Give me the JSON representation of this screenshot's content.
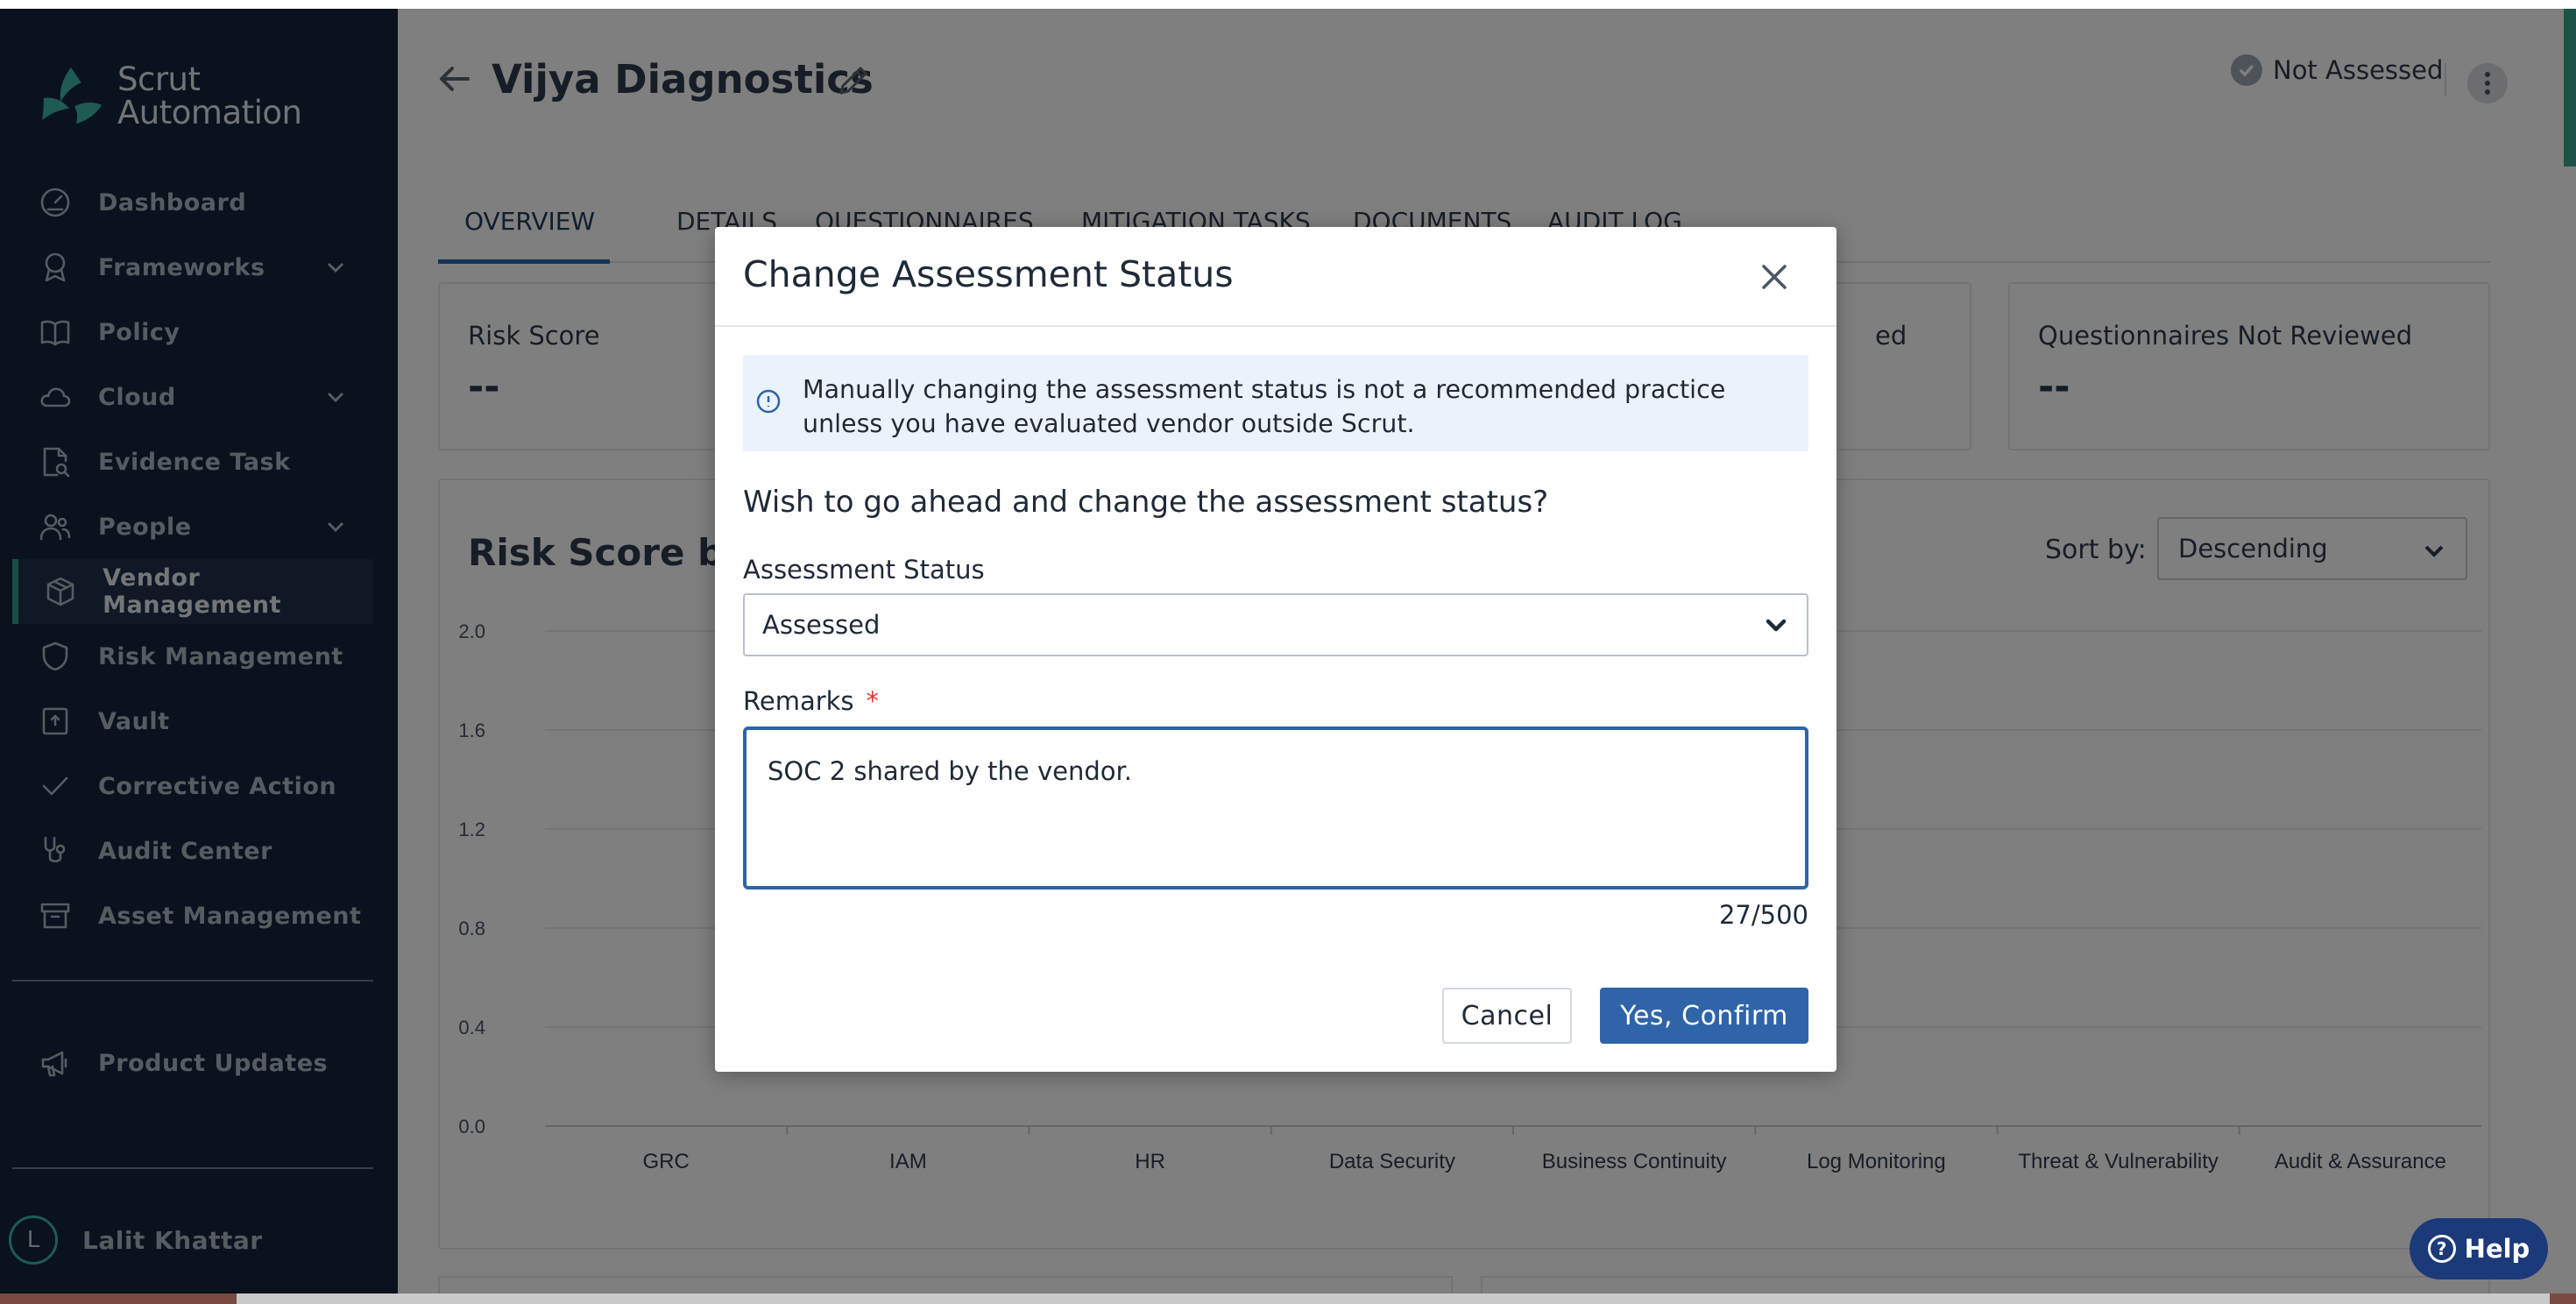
{
  "app": {
    "logo_line1": "Scrut",
    "logo_line2": "Automation"
  },
  "sidebar": {
    "items": [
      {
        "label": "Dashboard",
        "icon": "dashboard-gauge-icon",
        "has_chevron": false,
        "active": false
      },
      {
        "label": "Frameworks",
        "icon": "award-ribbon-icon",
        "has_chevron": true,
        "active": false
      },
      {
        "label": "Policy",
        "icon": "open-book-icon",
        "has_chevron": false,
        "active": false
      },
      {
        "label": "Cloud",
        "icon": "cloud-icon",
        "has_chevron": true,
        "active": false
      },
      {
        "label": "Evidence Task",
        "icon": "document-search-icon",
        "has_chevron": false,
        "active": false
      },
      {
        "label": "People",
        "icon": "people-icon",
        "has_chevron": true,
        "active": false
      },
      {
        "label": "Vendor Management",
        "icon": "box-icon",
        "has_chevron": false,
        "active": true
      },
      {
        "label": "Risk Management",
        "icon": "shield-icon",
        "has_chevron": false,
        "active": false
      },
      {
        "label": "Vault",
        "icon": "vault-icon",
        "has_chevron": false,
        "active": false
      },
      {
        "label": "Corrective Action",
        "icon": "checkmark-icon",
        "has_chevron": false,
        "active": false
      },
      {
        "label": "Audit Center",
        "icon": "stethoscope-icon",
        "has_chevron": false,
        "active": false
      },
      {
        "label": "Asset Management",
        "icon": "archive-box-icon",
        "has_chevron": false,
        "active": false
      }
    ],
    "secondary_items": [
      {
        "label": "Product Updates",
        "icon": "megaphone-icon"
      }
    ],
    "user": {
      "initial": "L",
      "name": "Lalit Khattar"
    }
  },
  "header": {
    "title": "Vijya Diagnostics",
    "status": "Not Assessed"
  },
  "tabs": [
    {
      "label": "OVERVIEW",
      "active": true
    },
    {
      "label": "DETAILS",
      "active": false
    },
    {
      "label": "QUESTIONNAIRES",
      "active": false
    },
    {
      "label": "MITIGATION TASKS",
      "active": false
    },
    {
      "label": "DOCUMENTS",
      "active": false
    },
    {
      "label": "AUDIT LOG",
      "active": false
    }
  ],
  "cards": [
    {
      "label": "Risk Score",
      "value": "--"
    },
    {
      "label": "ed",
      "value": ""
    },
    {
      "label": "Questionnaires Not Reviewed",
      "value": "--"
    }
  ],
  "chart_section": {
    "title": "Risk Score by D",
    "sort_label": "Sort by:",
    "sort_value": "Descending"
  },
  "chart_data": {
    "type": "bar",
    "title": "Risk Score by D",
    "categories": [
      "GRC",
      "IAM",
      "HR",
      "Data Security",
      "Business Continuity",
      "Log Monitoring",
      "Threat & Vulnerability",
      "Audit & Assurance"
    ],
    "values": [
      0,
      0,
      0,
      0,
      0,
      0,
      0,
      0
    ],
    "y_ticks": [
      "2.0",
      "1.6",
      "1.2",
      "0.8",
      "0.4",
      "0.0"
    ],
    "ylim": [
      0,
      2.0
    ],
    "grid": true
  },
  "modal": {
    "title": "Change Assessment Status",
    "info": "Manually changing the assessment status is not a recommended practice unless you have evaluated vendor outside Scrut.",
    "question": "Wish to go ahead and change the assessment status?",
    "status_label": "Assessment Status",
    "status_value": "Assessed",
    "remarks_label": "Remarks",
    "required_mark": "*",
    "remarks_value": "SOC 2 shared by the vendor.",
    "char_count": "27/500",
    "cancel_label": "Cancel",
    "confirm_label": "Yes, Confirm"
  },
  "help": {
    "label": "Help",
    "glyph": "?"
  },
  "colors": {
    "sidebar_bg": "#12243a",
    "accent": "#2f64a8",
    "active_indicator": "#2f9e8f",
    "help_bg": "#1c3a7a",
    "required": "#d93a3a"
  }
}
